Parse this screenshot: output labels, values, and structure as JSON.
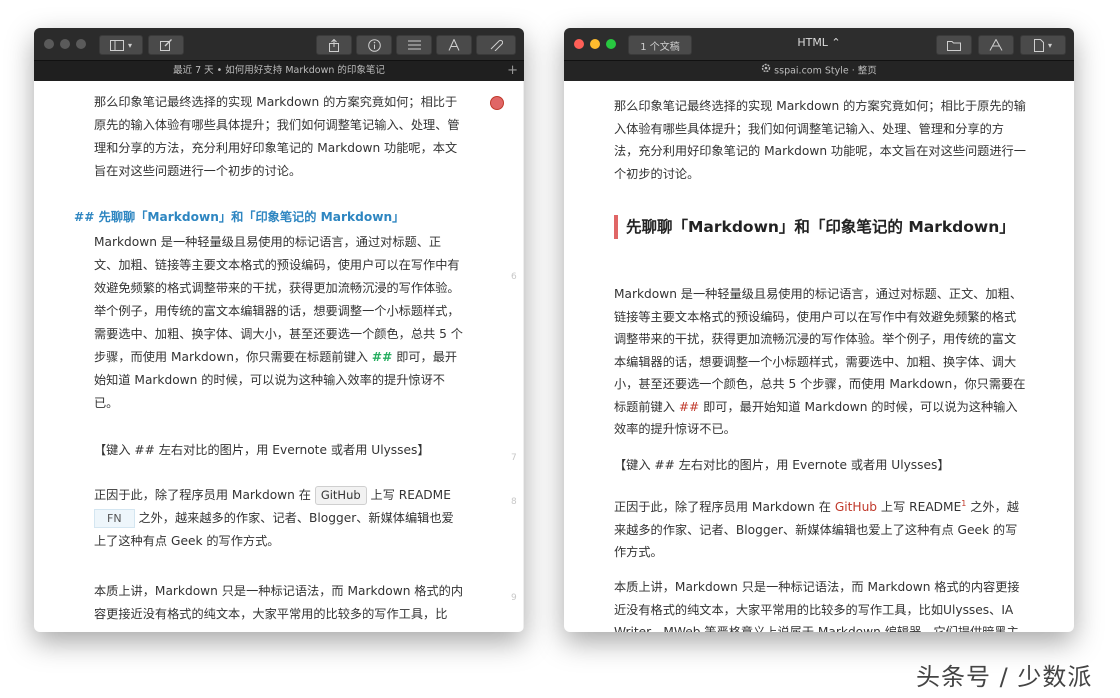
{
  "colors": {
    "red": "#ff5f57",
    "yellow": "#febc2e",
    "green": "#28c840",
    "accent_blue": "#2e86c1",
    "accent_red": "#c0392b"
  },
  "left": {
    "subtitle": "最近 7 天 • 如何用好支持 Markdown 的印象笔记",
    "plus": "+",
    "toolbar_icons": [
      "sidebar-icon",
      "compose-icon",
      "share-icon",
      "info-icon",
      "list-icon",
      "font-icon",
      "attachment-icon"
    ],
    "p1": "那么印象笔记最终选择的实现 Markdown 的方案究竟如何；相比于原先的输入体验有哪些具体提升；我们如何调整笔记输入、处理、管理和分享的方法，充分利用好印象笔记的 Markdown 功能呢，本文旨在对这些问题进行一个初步的讨论。",
    "heading": "## 先聊聊「Markdown」和「印象笔记的 Markdown」",
    "p2a": "Markdown 是一种轻量级且易使用的标记语言，通过对标题、正文、加粗、链接等主要文本格式的预设编码，使用户可以在写作中有效避免频繁的格式调整带来的干扰，获得更加流畅沉浸的写作体验。举个例子，用传统的富文本编辑器的话，想要调整一个小标题样式，需要选中、加粗、换字体、调大小，甚至还要选一个颜色，总共 5 个步骤，而使用 Markdown，你只需要在标题前键入",
    "p2hash": "##",
    "p2b": "即可，最开始知道 Markdown 的时候，可以说为这种输入效率的提升惊讶不已。",
    "p3": "【键入 ## 左右对比的图片，用 Evernote 或者用 Ulysses】",
    "p4a": "正因于此，除了程序员用 Markdown 在",
    "p4code": "GitHub",
    "p4b": "上写 README",
    "p4fn": "FN",
    "p4c": "之外，越来越多的作家、记者、Blogger、新媒体编辑也爱上了这种有点 Geek 的写作方式。",
    "p5": "本质上讲，Markdown 只是一种标记语法，而 Markdown 格式的内容更接近没有格式的纯文本，大家平常用的比较多的写作工具，比",
    "linenos": [
      "6",
      "7",
      "8",
      "9"
    ]
  },
  "right": {
    "doc_button": "1 个文稿",
    "format": "HTML ⌃",
    "style_title": "sspai.com Style · 整页",
    "toolbar_icons": [
      "folder-icon",
      "style-icon",
      "export-icon"
    ],
    "p1": "那么印象笔记最终选择的实现 Markdown 的方案究竟如何；相比于原先的输入体验有哪些具体提升；我们如何调整笔记输入、处理、管理和分享的方法，充分利用好印象笔记的 Markdown 功能呢，本文旨在对这些问题进行一个初步的讨论。",
    "heading": "先聊聊「Markdown」和「印象笔记的 Markdown」",
    "p2a": "Markdown 是一种轻量级且易使用的标记语言，通过对标题、正文、加粗、链接等主要文本格式的预设编码，使用户可以在写作中有效避免频繁的格式调整带来的干扰，获得更加流畅沉浸的写作体验。举个例子，用传统的富文本编辑器的话，想要调整一个小标题样式，需要选中、加粗、换字体、调大小，甚至还要选一个颜色，总共 5 个步骤，而使用 Markdown，你只需要在标题前键入",
    "p2hash": "##",
    "p2b": "即可，最开始知道 Markdown 的时候，可以说为这种输入效率的提升惊讶不已。",
    "p3": "【键入 ## 左右对比的图片，用 Evernote 或者用 Ulysses】",
    "p4a": "正因于此，除了程序员用 Markdown 在",
    "p4link": "GitHub",
    "p4b": "上写 README",
    "p4sup": "1",
    "p4c": "之外，越来越多的作家、记者、Blogger、新媒体编辑也爱上了这种有点 Geek 的写作方式。",
    "p5": "本质上讲，Markdown 只是一种标记语法，而 Markdown 格式的内容更接近没有格式的纯文本，大家平常用的比较多的写作工具，比如Ulysses、IA Writer、MWeb 等严格意义上说属于 Markdown 编辑器，它们提供暗黑主"
  },
  "watermark": "头条号 / 少数派"
}
